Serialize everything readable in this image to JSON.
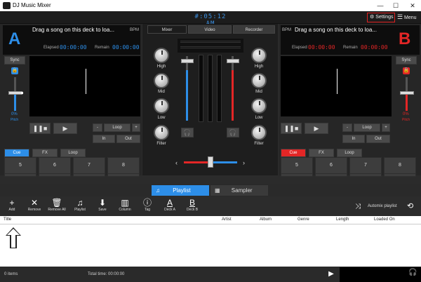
{
  "app": {
    "title": "DJ Music Mixer"
  },
  "window_controls": {
    "minimize": "—",
    "maximize": "☐",
    "close": "✕"
  },
  "header": {
    "clock": "#:05:12 AM",
    "settings_label": "Settings",
    "menu_label": "Menu"
  },
  "deck_a": {
    "letter": "A",
    "song": "Drag a song on this deck to loa...",
    "bpm_label": "BPM",
    "elapsed_label": "Elapsed",
    "elapsed": "00:00:00",
    "remain_label": "Remain",
    "remain": "00:00:00",
    "sync_label": "Sync",
    "pitch_value": "0%",
    "pitch_label": "Pitch",
    "loop_minus": "-",
    "loop_label": "Loop",
    "loop_plus": "+",
    "in_label": "In",
    "out_label": "Out",
    "tabs": [
      "Cue",
      "FX",
      "Loop"
    ],
    "pads": [
      "1",
      "2",
      "3",
      "4",
      "5",
      "6",
      "7",
      "8"
    ],
    "accent": "#2d8ee8"
  },
  "deck_b": {
    "letter": "B",
    "song": "Drag a song on this deck to loa...",
    "bpm_label": "BPM",
    "elapsed_label": "Elapsed",
    "elapsed": "00:00:00",
    "remain_label": "Remain",
    "remain": "00:00:00",
    "sync_label": "Sync",
    "pitch_value": "0%",
    "pitch_label": "Pitch",
    "loop_minus": "-",
    "loop_label": "Loop",
    "loop_plus": "+",
    "in_label": "In",
    "out_label": "Out",
    "tabs": [
      "Cue",
      "FX",
      "Loop"
    ],
    "pads": [
      "1",
      "2",
      "3",
      "4",
      "5",
      "6",
      "7",
      "8"
    ],
    "accent": "#e32626"
  },
  "mixer": {
    "tabs": [
      "Mixer",
      "Video",
      "Recorder"
    ],
    "knobs": [
      "High",
      "Mid",
      "Low",
      "Filter"
    ]
  },
  "bottom_tabs": {
    "playlist": "Playlist",
    "sampler": "Sampler"
  },
  "toolbar": [
    {
      "icon": "add-icon",
      "label": "Add"
    },
    {
      "icon": "remove-icon",
      "label": "Remove"
    },
    {
      "icon": "remove-all-icon",
      "label": "Remove All"
    },
    {
      "icon": "playlist-icon",
      "label": "Playlist"
    },
    {
      "icon": "save-icon",
      "label": "Save"
    },
    {
      "icon": "column-icon",
      "label": "Column"
    },
    {
      "icon": "tag-icon",
      "label": "Tag"
    },
    {
      "icon": "deck-a-icon",
      "label": "Deck A"
    },
    {
      "icon": "deck-b-icon",
      "label": "Deck B"
    }
  ],
  "automix": {
    "label": "Automix playlist"
  },
  "columns": [
    "Title",
    "Artist",
    "Album",
    "Genre",
    "Length",
    "Loaded On"
  ],
  "status": {
    "items": "0 items",
    "total_time": "Total time: 00:00:00"
  }
}
